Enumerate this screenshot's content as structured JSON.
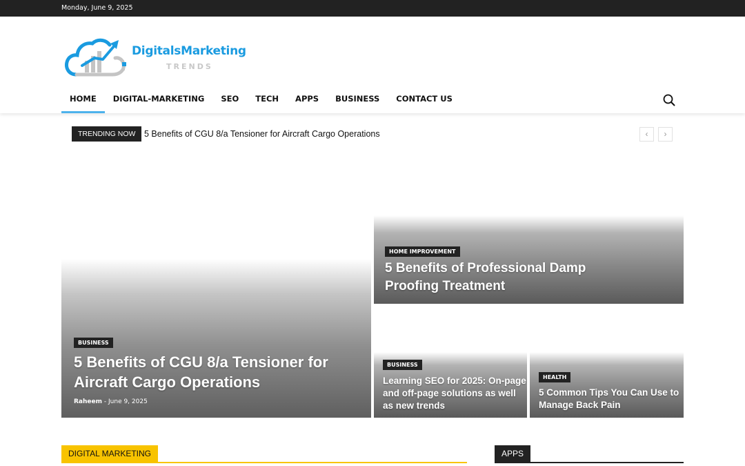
{
  "topbar": {
    "date": "Monday, June 9, 2025"
  },
  "logo": {
    "brand": "DigitalsMarketing",
    "sub": "TRENDS"
  },
  "nav": {
    "items": [
      {
        "label": "HOME"
      },
      {
        "label": "DIGITAL-MARKETING"
      },
      {
        "label": "SEO"
      },
      {
        "label": "TECH"
      },
      {
        "label": "APPS"
      },
      {
        "label": "BUSINESS"
      },
      {
        "label": "CONTACT US"
      }
    ],
    "active": "HOME",
    "accent_color": "#4db2ec"
  },
  "trending": {
    "label": "TRENDING NOW",
    "headline": "5 Benefits of CGU 8/a Tensioner for Aircraft Cargo Operations",
    "prev_icon": "‹",
    "next_icon": "›"
  },
  "featured": {
    "main": {
      "category": "BUSINESS",
      "title_line1": "5 Benefits of CGU 8/a Tensioner for",
      "title_line2": "Aircraft Cargo Operations",
      "author": "Raheem",
      "separator": "-",
      "date": "June 9, 2025"
    },
    "top_right": {
      "category": "HOME IMPROVEMENT",
      "title_line1": "5 Benefits of Professional Damp",
      "title_line2": "Proofing Treatment"
    },
    "bottom_left": {
      "category": "BUSINESS",
      "title_line1": "Learning SEO for 2025: On-page",
      "title_line2": "and off-page solutions as well",
      "title_line3": "as new trends"
    },
    "bottom_right": {
      "category": "HEALTH",
      "title_line1": "5 Common Tips You Can Use to",
      "title_line2": "Manage Back Pain"
    }
  },
  "sections": {
    "left": {
      "label": "DIGITAL MARKETING",
      "color": "#f8c300"
    },
    "right": {
      "label": "APPS",
      "color": "#222222"
    }
  }
}
